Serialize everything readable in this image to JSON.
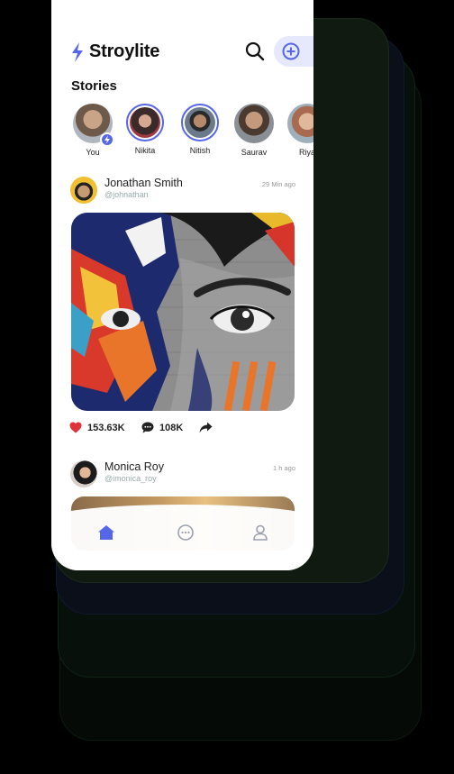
{
  "app": {
    "title": "Stroylite",
    "accent": "#5566e8"
  },
  "header": {
    "search_icon": "search-icon",
    "add_icon": "plus-circle-icon"
  },
  "stories": {
    "title": "Stories",
    "items": [
      {
        "name": "You",
        "badge": "bolt"
      },
      {
        "name": "Nikita"
      },
      {
        "name": "Nitish"
      },
      {
        "name": "Saurav"
      },
      {
        "name": "Riya"
      }
    ]
  },
  "posts": [
    {
      "author": "Jonathan Smith",
      "handle": "@johnathan",
      "time": "29 Min ago",
      "likes": "153.63K",
      "comments": "108K"
    },
    {
      "author": "Monica Roy",
      "handle": "@imonica_roy",
      "time": "1 h ago"
    }
  ],
  "nav": {
    "items": [
      "home-icon",
      "chat-icon",
      "profile-icon"
    ]
  }
}
